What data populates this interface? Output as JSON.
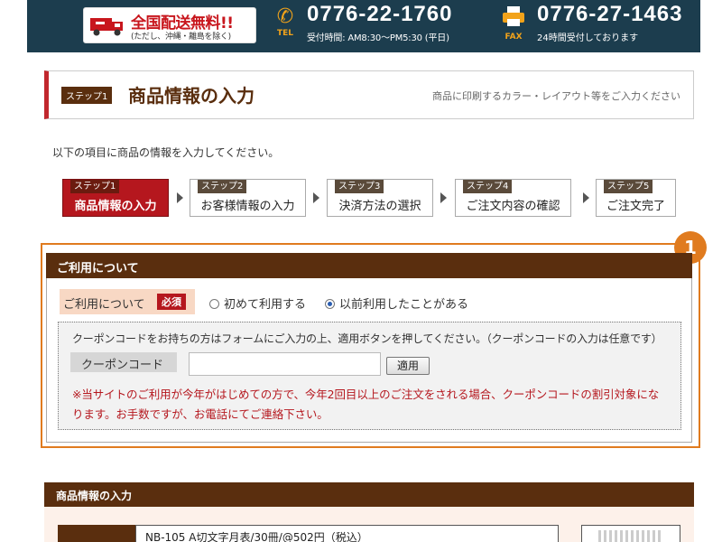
{
  "banner": {
    "free_shipping": "全国配送無料!!",
    "free_shipping_note": "(ただし、沖縄・離島を除く)",
    "tel_label": "TEL",
    "tel_number": "0776-22-1760",
    "tel_hours": "受付時間: AM8:30〜PM5:30 (平日)",
    "fax_label": "FAX",
    "fax_number": "0776-27-1463",
    "fax_hours": "24時間受付しております"
  },
  "step_heading": {
    "tag": "ステップ1",
    "title": "商品情報の入力",
    "note": "商品に印刷するカラー・レイアウト等をご入力ください"
  },
  "intro": "以下の項目に商品の情報を入力してください。",
  "progress_steps": [
    {
      "tag": "ステップ1",
      "label": "商品情報の入力",
      "active": true
    },
    {
      "tag": "ステップ2",
      "label": "お客様情報の入力",
      "active": false
    },
    {
      "tag": "ステップ3",
      "label": "決済方法の選択",
      "active": false
    },
    {
      "tag": "ステップ4",
      "label": "ご注文内容の確認",
      "active": false
    },
    {
      "tag": "ステップ5",
      "label": "ご注文完了",
      "active": false
    }
  ],
  "usage": {
    "badge": "1",
    "header": "ご利用について",
    "label": "ご利用について",
    "required": "必須",
    "option_first": "初めて利用する",
    "option_repeat": "以前利用したことがある",
    "selected": "option_repeat",
    "coupon_desc": "クーポンコードをお持ちの方はフォームにご入力の上、適用ボタンを押してください。（クーポンコードの入力は任意です）",
    "coupon_label": "クーポンコード",
    "coupon_value": "",
    "apply_button": "適用",
    "note": "※当サイトのご利用が今年がはじめての方で、今年2回目以上のご注文をされる場合、クーポンコードの割引対象になります。お手数ですが、お電話にてご連絡下さい。"
  },
  "product": {
    "header": "商品情報の入力",
    "name": "NB-105 A切文字月表/30冊/@502円（税込）"
  },
  "colors": {
    "navy": "#1c3d4e",
    "brown": "#5a2e0e",
    "red": "#b5171e",
    "orange": "#e07b1f"
  }
}
